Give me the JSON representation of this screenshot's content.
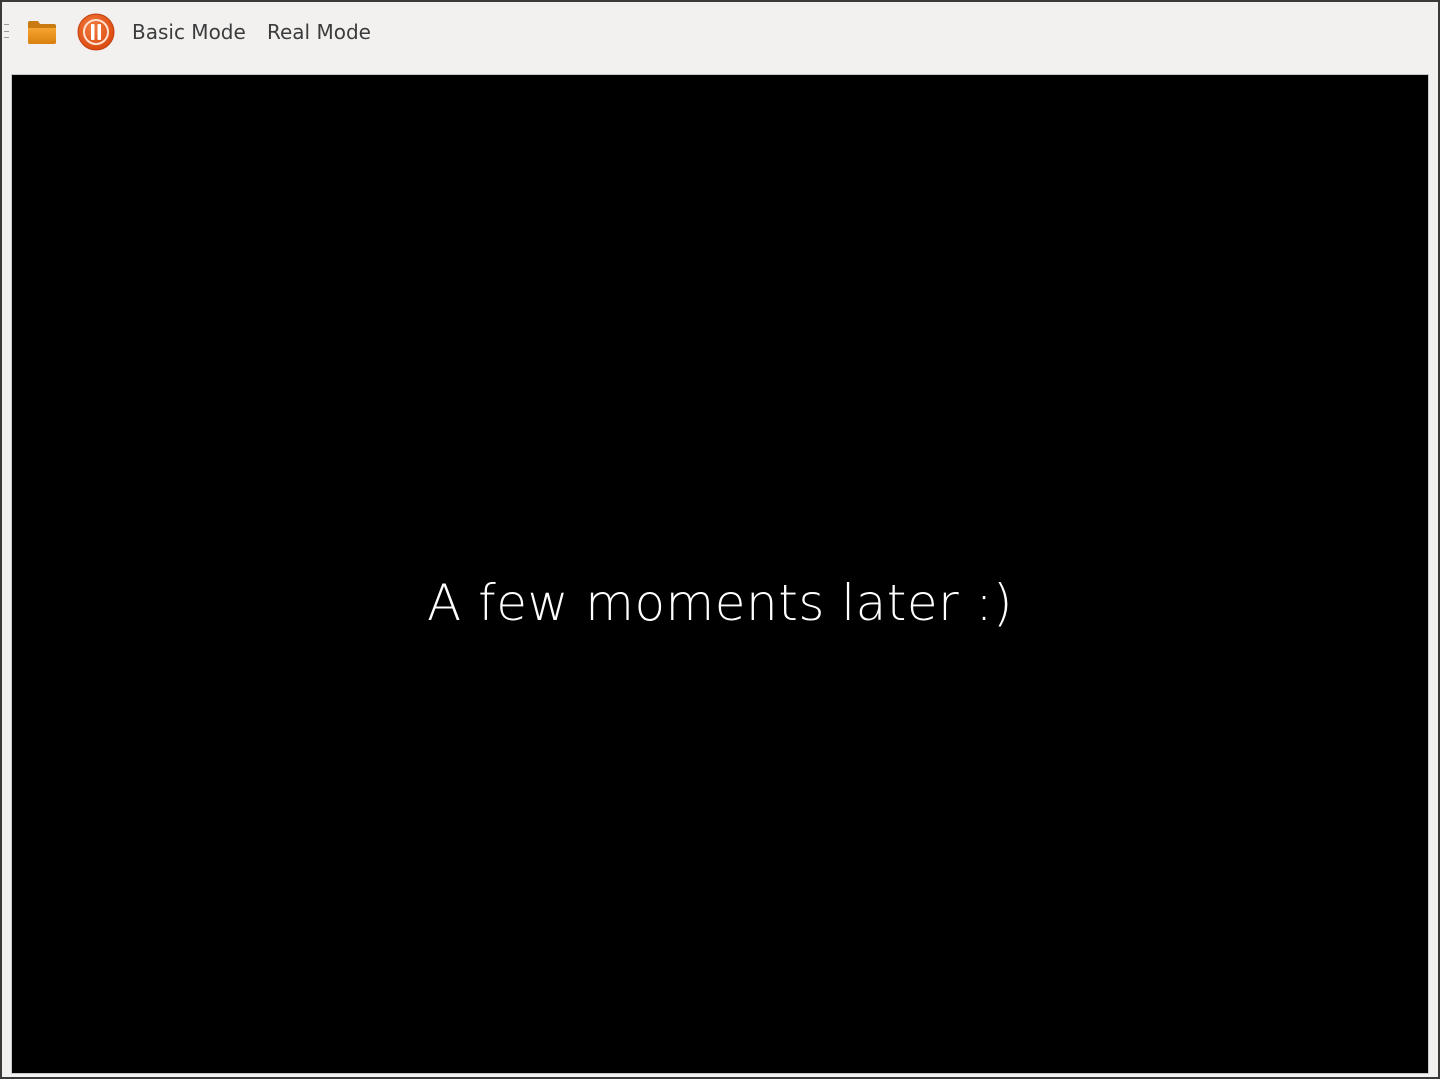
{
  "toolbar": {
    "open_icon": "folder-icon",
    "pause_icon": "pause-icon",
    "basic_mode_label": "Basic Mode",
    "real_mode_label": "Real Mode"
  },
  "canvas": {
    "message": "A few moments later :)",
    "background": "#000000",
    "text_color": "#ffffff"
  },
  "colors": {
    "accent_orange": "#e95420",
    "folder_orange": "#f39c12",
    "toolbar_bg": "#f2f1f0"
  }
}
